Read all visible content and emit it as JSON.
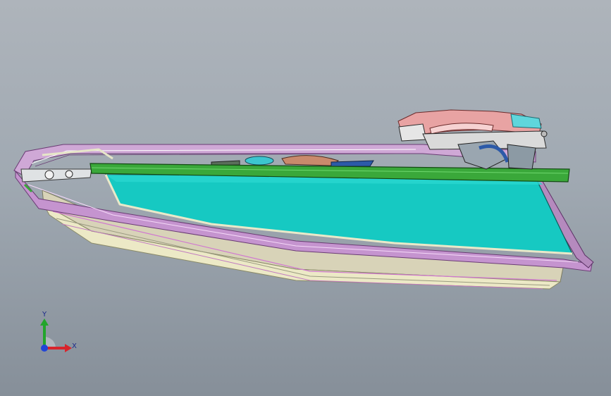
{
  "viewport": {
    "background_top": "#aeb4bb",
    "background_bottom": "#868f99"
  },
  "model": {
    "glass_color": "#16c9c2",
    "frame_color": "#c9a2d0",
    "belt_strip_color": "#3aa83a",
    "handle_color": "#e8a3a3",
    "handle_accent_color": "#5fd6dc",
    "skin_color": "#e8e8c2"
  },
  "triad": {
    "x_label": "X",
    "y_label": "Y",
    "x_axis_color": "#d8242c",
    "y_axis_color": "#22a52c",
    "z_axis_color": "#2245d6",
    "icon": "coordinate-triad-icon"
  }
}
